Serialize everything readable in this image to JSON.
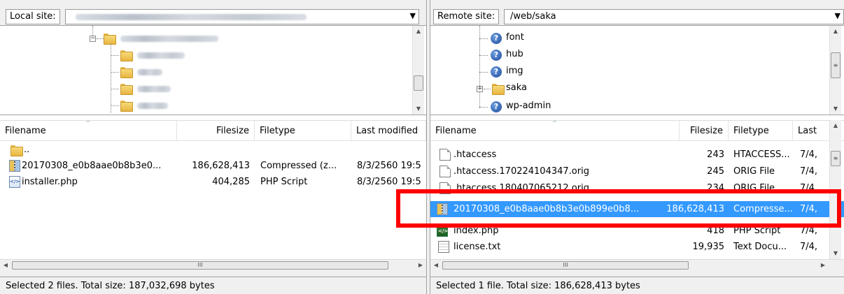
{
  "local": {
    "site_label": "Local site:",
    "tree": [
      {
        "name": "site-folder",
        "blurred": true
      },
      {
        "name": "sub1",
        "blurred": true
      },
      {
        "name": "sub2",
        "blurred": true
      },
      {
        "name": "sub3",
        "blurred": true
      },
      {
        "name": "sub4",
        "blurred": true
      }
    ],
    "columns": {
      "filename": "Filename",
      "filesize": "Filesize",
      "filetype": "Filetype",
      "modified": "Last modified"
    },
    "rows": [
      {
        "name": "..",
        "size": "",
        "type": "",
        "modified": "",
        "icon": "folder-icon"
      },
      {
        "name": "20170308_e0b8aae0b8b3e0...",
        "size": "186,628,413",
        "type": "Compressed (z...",
        "modified": "8/3/2560 19:5",
        "icon": "zip-icon"
      },
      {
        "name": "installer.php",
        "size": "404,285",
        "type": "PHP Script",
        "modified": "8/3/2560 19:5",
        "icon": "php-icon"
      }
    ],
    "status": "Selected 2 files. Total size: 187,032,698 bytes"
  },
  "remote": {
    "site_label": "Remote site:",
    "site_path": "/web/saka",
    "tree": [
      {
        "name": "font",
        "icon": "unknown-folder-icon"
      },
      {
        "name": "hub",
        "icon": "unknown-folder-icon"
      },
      {
        "name": "img",
        "icon": "unknown-folder-icon"
      },
      {
        "name": "saka",
        "icon": "folder-icon"
      },
      {
        "name": "wp-admin",
        "icon": "unknown-folder-icon"
      }
    ],
    "columns": {
      "filename": "Filename",
      "filesize": "Filesize",
      "filetype": "Filetype",
      "modified": "Last"
    },
    "rows": [
      {
        "name": ".htaccess",
        "size": "243",
        "type": "HTACCESS...",
        "modified": "7/4,",
        "icon": "file-icon"
      },
      {
        "name": ".htaccess.170224104347.orig",
        "size": "245",
        "type": "ORIG File",
        "modified": "7/4,",
        "icon": "file-icon"
      },
      {
        "name": ".htaccess.180407065212.orig",
        "size": "234",
        "type": "ORIG File",
        "modified": "7/4,",
        "icon": "file-icon"
      },
      {
        "name": "20170308_e0b8aae0b8b3e0b899e0b8...",
        "size": "186,628,413",
        "type": "Compresse...",
        "modified": "7/4,",
        "icon": "zip-icon",
        "selected": true
      },
      {
        "name": "index.php",
        "size": "418",
        "type": "PHP Script",
        "modified": "7/4,",
        "icon": "php-icon"
      },
      {
        "name": "license.txt",
        "size": "19,935",
        "type": "Text Docu...",
        "modified": "7/4,",
        "icon": "text-file-icon"
      }
    ],
    "status": "Selected 1 file. Total size: 186,628,413 bytes"
  },
  "scroll_grip": "III",
  "colors": {
    "selection": "#3399ff",
    "highlight_box": "#ff0000"
  }
}
